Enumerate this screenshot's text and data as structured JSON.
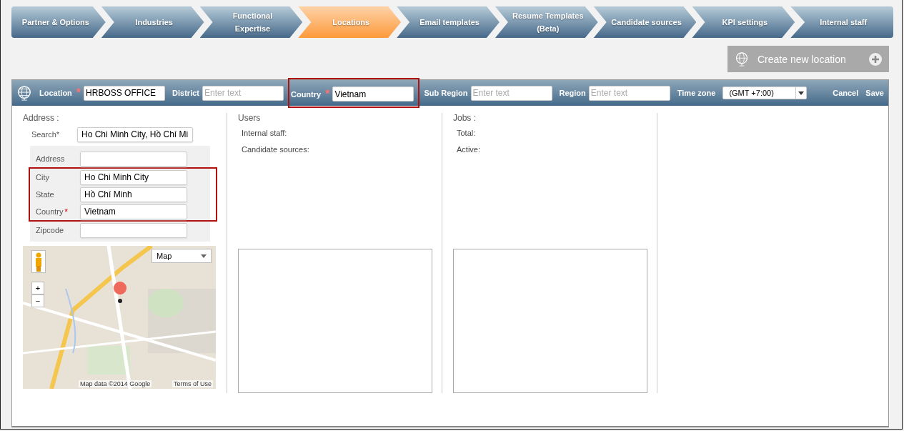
{
  "steps": [
    {
      "label": "Partner & Options",
      "selected": false
    },
    {
      "label": "Industries",
      "selected": false
    },
    {
      "label": "Functional Expertise",
      "selected": false
    },
    {
      "label": "Locations",
      "selected": true
    },
    {
      "label": "Email templates",
      "selected": false
    },
    {
      "label": "Resume Templates (Beta)",
      "selected": false
    },
    {
      "label": "Candidate sources",
      "selected": false
    },
    {
      "label": "KPI settings",
      "selected": false
    },
    {
      "label": "Internal staff",
      "selected": false
    }
  ],
  "create_button": {
    "label": "Create new location"
  },
  "toolbar": {
    "fields": [
      {
        "label": "Location",
        "required_mark": "*",
        "value": "HRBOSS OFFICE",
        "highlighted": false
      },
      {
        "label": "District",
        "placeholder": "Enter text",
        "highlighted": false
      },
      {
        "label": "Country",
        "required_mark": "*",
        "value": "Vietnam",
        "highlighted": true
      },
      {
        "label": "Sub Region",
        "placeholder": "Enter text",
        "highlighted": false
      },
      {
        "label": "Region",
        "placeholder": "Enter text",
        "highlighted": false
      }
    ],
    "timezone": {
      "label": "Time zone",
      "value": "(GMT +7:00)"
    },
    "actions": [
      "Cancel",
      "Save"
    ]
  },
  "address": {
    "title": "Address :",
    "search": {
      "label": "Search*",
      "value": "Ho Chi Minh City, Hồ Chí Mi"
    },
    "groups": [
      {
        "highlighted": false,
        "fields": [
          {
            "label": "Address"
          }
        ]
      },
      {
        "highlighted": true,
        "fields": [
          {
            "label": "City",
            "value": "Ho Chi Minh City"
          },
          {
            "label": "State",
            "value": "Hồ Chí Minh"
          },
          {
            "label": "Country",
            "required_mark": "*",
            "value": "Vietnam"
          }
        ]
      },
      {
        "highlighted": false,
        "fields": [
          {
            "label": "Zipcode"
          }
        ]
      }
    ],
    "map": {
      "type_select": "Map",
      "zoom_in": "+",
      "zoom_out": "−",
      "attribution": "Map data ©2014 Google",
      "terms": "Terms of Use"
    }
  },
  "users": {
    "title": "Users",
    "rows": [
      "Internal staff:",
      "Candidate sources:"
    ]
  },
  "jobs": {
    "title": "Jobs :",
    "rows": [
      "Total:",
      "Active:"
    ]
  }
}
